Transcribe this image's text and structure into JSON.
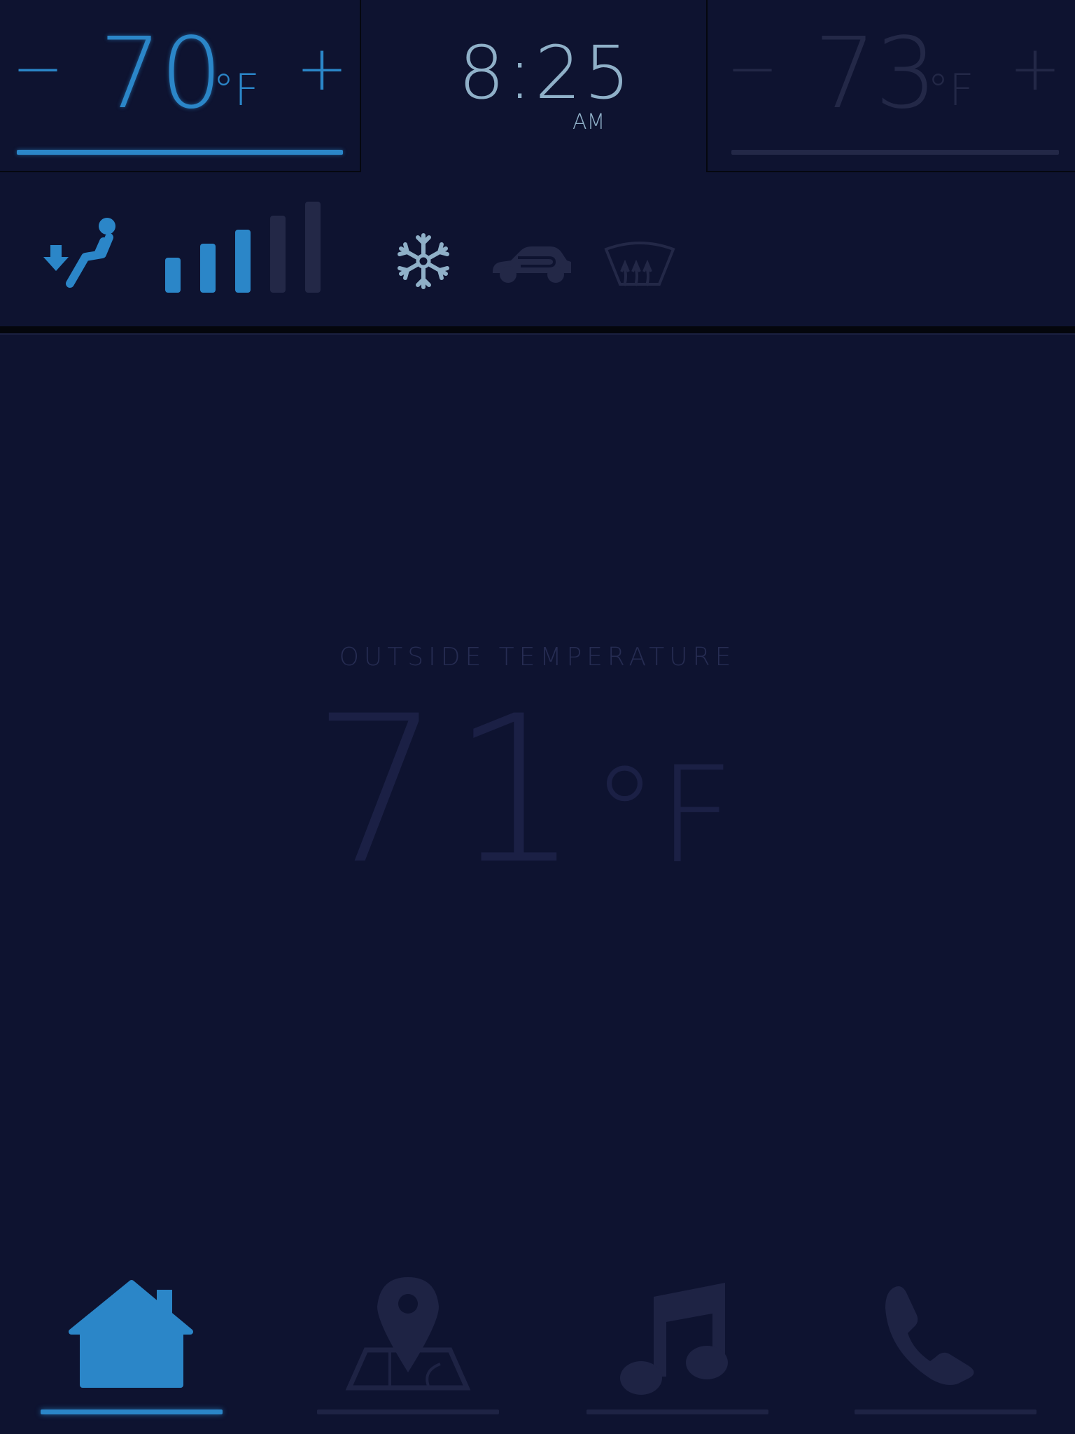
{
  "driver_temp": {
    "value": "70",
    "unit": "°F",
    "minus": "−",
    "plus": "+"
  },
  "clock": {
    "time": "8:25",
    "period": "AM"
  },
  "passenger_temp": {
    "value": "73",
    "unit": "°F",
    "minus": "−",
    "plus": "+"
  },
  "climate": {
    "fan_level": 3,
    "fan_max": 5,
    "icons": [
      "seat-airflow-icon",
      "fan-speed-icon",
      "ac-snowflake-icon",
      "recirculation-icon",
      "windshield-defrost-icon"
    ]
  },
  "outside": {
    "label": "OUTSIDE TEMPERATURE",
    "value": "71",
    "unit": "°F"
  },
  "nav": {
    "items": [
      {
        "name": "home",
        "icon": "home-icon",
        "active": true
      },
      {
        "name": "navigation",
        "icon": "map-pin-icon",
        "active": false
      },
      {
        "name": "music",
        "icon": "music-note-icon",
        "active": false
      },
      {
        "name": "phone",
        "icon": "phone-icon",
        "active": false
      }
    ]
  },
  "colors": {
    "accent": "#2b86c8",
    "background": "#0e1330",
    "dim": "#232847",
    "clock": "#8fb0c8"
  }
}
